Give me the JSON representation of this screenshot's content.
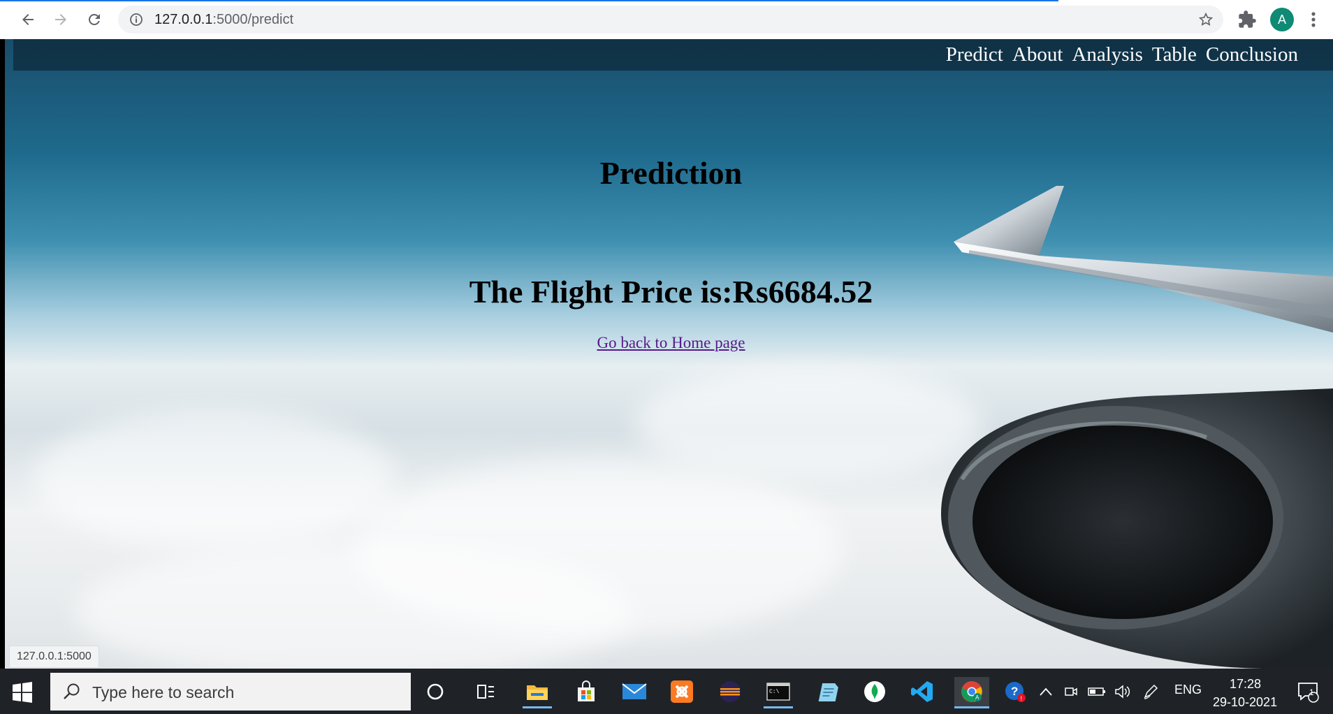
{
  "browser": {
    "url_host": "127.0.0.1",
    "url_rest": ":5000/predict",
    "profile_initial": "A",
    "accent": "#1a73e8"
  },
  "navbar": {
    "links": [
      "Predict",
      "About",
      "Analysis",
      "Table",
      "Conclusion"
    ]
  },
  "main": {
    "heading": "Prediction",
    "price_text": "The Flight Price is:Rs6684.52",
    "home_link": "Go back to Home page"
  },
  "status_bar": {
    "hover_url": "127.0.0.1:5000"
  },
  "taskbar": {
    "search_placeholder": "Type here to search",
    "language": "ENG",
    "time": "17:28",
    "date": "29-10-2021",
    "notification_count": "1",
    "apps": [
      "cortana-icon",
      "task-view-icon",
      "file-explorer-icon",
      "store-icon",
      "mail-icon",
      "xampp-icon",
      "eclipse-icon",
      "terminal-icon",
      "notepad-icon",
      "mongodb-icon",
      "vscode-icon",
      "chrome-icon"
    ]
  }
}
